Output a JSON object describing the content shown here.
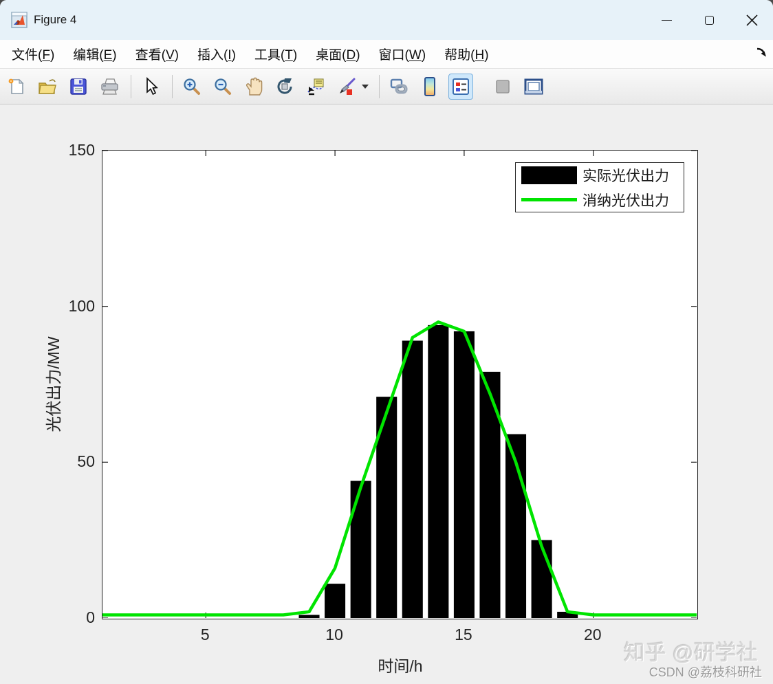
{
  "window": {
    "title": "Figure 4",
    "controls": {
      "minimize": "minimize",
      "maximize": "maximize",
      "close": "close"
    }
  },
  "menu_bar": {
    "items": [
      {
        "text": "文件",
        "key": "F"
      },
      {
        "text": "编辑",
        "key": "E"
      },
      {
        "text": "查看",
        "key": "V"
      },
      {
        "text": "插入",
        "key": "I"
      },
      {
        "text": "工具",
        "key": "T"
      },
      {
        "text": "桌面",
        "key": "D"
      },
      {
        "text": "窗口",
        "key": "W"
      },
      {
        "text": "帮助",
        "key": "H"
      }
    ]
  },
  "toolbar": {
    "icons": [
      "new-figure",
      "open-file",
      "save-figure",
      "print-figure",
      "edit-plot-arrow",
      "zoom-in",
      "zoom-out",
      "pan-hand",
      "rotate-3d",
      "data-cursor",
      "brush-data",
      "brush-dropdown",
      "link-plot",
      "insert-colorbar",
      "insert-legend",
      "plottools-disabled",
      "dock-figure"
    ],
    "active_icon": "insert-legend"
  },
  "chart_data": {
    "type": "bar+line",
    "x": [
      1,
      2,
      3,
      4,
      5,
      6,
      7,
      8,
      9,
      10,
      11,
      12,
      13,
      14,
      15,
      16,
      17,
      18,
      19,
      20,
      21,
      22,
      23,
      24
    ],
    "series": [
      {
        "name": "实际光伏出力",
        "type": "bar",
        "color": "#000000",
        "values": [
          0,
          0,
          0,
          0,
          0,
          0,
          0,
          0,
          1,
          11,
          44,
          71,
          89,
          94,
          92,
          79,
          59,
          25,
          2,
          0,
          0,
          0,
          0,
          0
        ]
      },
      {
        "name": "消纳光伏出力",
        "type": "line",
        "color": "#00e400",
        "values": [
          1,
          1,
          1,
          1,
          1,
          1,
          1,
          1,
          2,
          16,
          42,
          66,
          90,
          95,
          92,
          72,
          50,
          23,
          2,
          1,
          1,
          1,
          1,
          1
        ]
      }
    ],
    "xlabel": "时间/h",
    "ylabel": "光伏出力/MW",
    "xlim": [
      1,
      24
    ],
    "ylim": [
      0,
      150
    ],
    "xticks": [
      5,
      10,
      15,
      20
    ],
    "yticks": [
      0,
      50,
      100,
      150
    ],
    "grid": false,
    "legend_position": "top-right",
    "bar_width_fraction": 0.8
  },
  "watermark": {
    "line1": "知乎 @研学社",
    "line2": "CSDN @荔枝科研社"
  },
  "colors": {
    "titlebar_bg": "#e7f2f9",
    "figure_bg": "#efefef",
    "bar_black": "#000000",
    "line_green": "#00e400",
    "legend_active_bg": "#cfe8fb"
  }
}
